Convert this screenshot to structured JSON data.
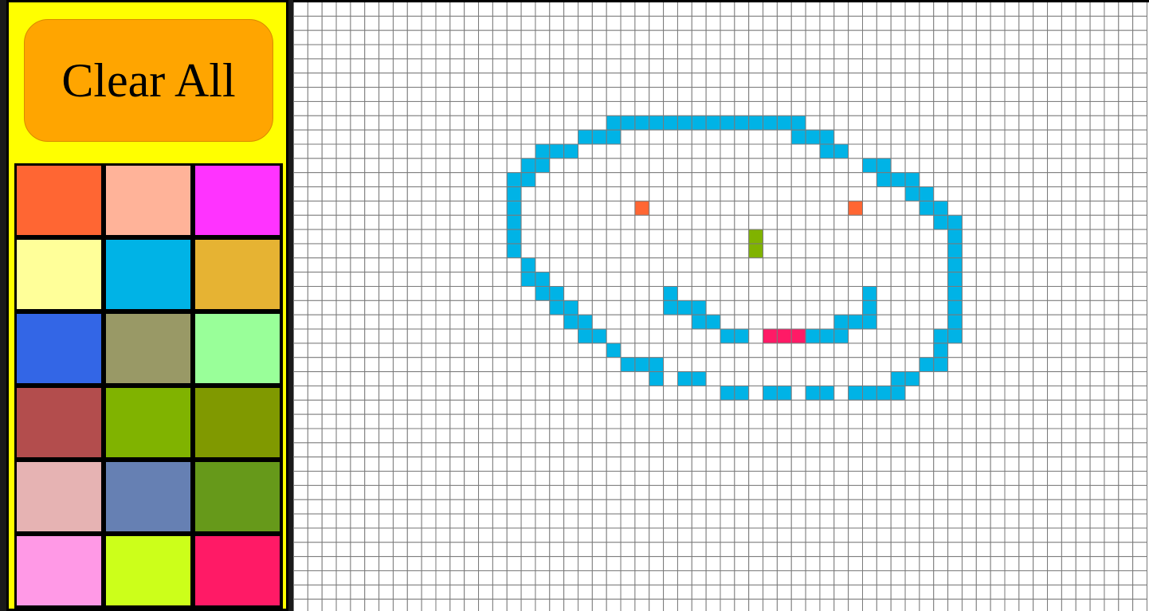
{
  "toolbar": {
    "clear_label": "Clear All"
  },
  "palette": {
    "colors": [
      "#ff6633",
      "#ffb399",
      "#ff33ff",
      "#ffff99",
      "#00b3e6",
      "#e6b333",
      "#3366e6",
      "#999966",
      "#99ff99",
      "#b34d4d",
      "#80b300",
      "#809900",
      "#e6b3b3",
      "#6680b3",
      "#66991a",
      "#ff99e6",
      "#ccff1a",
      "#ff1a66"
    ]
  },
  "grid": {
    "columns": 60,
    "rows": 43,
    "background": "#ffffff",
    "line_color": "#7a7a7a",
    "painted": [
      {
        "color": "#00b3e6",
        "cells": [
          [
            22,
            8
          ],
          [
            23,
            8
          ],
          [
            24,
            8
          ],
          [
            25,
            8
          ],
          [
            26,
            8
          ],
          [
            27,
            8
          ],
          [
            28,
            8
          ],
          [
            29,
            8
          ],
          [
            30,
            8
          ],
          [
            31,
            8
          ],
          [
            32,
            8
          ],
          [
            33,
            8
          ],
          [
            34,
            8
          ],
          [
            35,
            8
          ],
          [
            20,
            9
          ],
          [
            21,
            9
          ],
          [
            22,
            9
          ],
          [
            35,
            9
          ],
          [
            36,
            9
          ],
          [
            37,
            9
          ],
          [
            17,
            10
          ],
          [
            18,
            10
          ],
          [
            19,
            10
          ],
          [
            37,
            10
          ],
          [
            38,
            10
          ],
          [
            16,
            11
          ],
          [
            17,
            11
          ],
          [
            40,
            11
          ],
          [
            41,
            11
          ],
          [
            15,
            12
          ],
          [
            16,
            12
          ],
          [
            41,
            12
          ],
          [
            42,
            12
          ],
          [
            43,
            12
          ],
          [
            15,
            13
          ],
          [
            43,
            13
          ],
          [
            44,
            13
          ],
          [
            15,
            14
          ],
          [
            44,
            14
          ],
          [
            45,
            14
          ],
          [
            15,
            15
          ],
          [
            45,
            15
          ],
          [
            46,
            15
          ],
          [
            15,
            16
          ],
          [
            46,
            16
          ],
          [
            15,
            17
          ],
          [
            46,
            17
          ],
          [
            16,
            18
          ],
          [
            46,
            18
          ],
          [
            16,
            19
          ],
          [
            17,
            19
          ],
          [
            46,
            19
          ],
          [
            17,
            20
          ],
          [
            18,
            20
          ],
          [
            26,
            20
          ],
          [
            40,
            20
          ],
          [
            46,
            20
          ],
          [
            18,
            21
          ],
          [
            19,
            21
          ],
          [
            26,
            21
          ],
          [
            27,
            21
          ],
          [
            28,
            21
          ],
          [
            40,
            21
          ],
          [
            46,
            21
          ],
          [
            19,
            22
          ],
          [
            20,
            22
          ],
          [
            28,
            22
          ],
          [
            29,
            22
          ],
          [
            38,
            22
          ],
          [
            39,
            22
          ],
          [
            40,
            22
          ],
          [
            46,
            22
          ],
          [
            20,
            23
          ],
          [
            21,
            23
          ],
          [
            30,
            23
          ],
          [
            31,
            23
          ],
          [
            36,
            23
          ],
          [
            37,
            23
          ],
          [
            38,
            23
          ],
          [
            45,
            23
          ],
          [
            46,
            23
          ],
          [
            22,
            24
          ],
          [
            45,
            24
          ],
          [
            23,
            25
          ],
          [
            24,
            25
          ],
          [
            25,
            25
          ],
          [
            44,
            25
          ],
          [
            45,
            25
          ],
          [
            25,
            26
          ],
          [
            27,
            26
          ],
          [
            28,
            26
          ],
          [
            42,
            26
          ],
          [
            43,
            26
          ],
          [
            30,
            27
          ],
          [
            31,
            27
          ],
          [
            33,
            27
          ],
          [
            34,
            27
          ],
          [
            36,
            27
          ],
          [
            37,
            27
          ],
          [
            39,
            27
          ],
          [
            40,
            27
          ],
          [
            41,
            27
          ],
          [
            42,
            27
          ]
        ]
      },
      {
        "color": "#ff6633",
        "cells": [
          [
            24,
            14
          ],
          [
            39,
            14
          ]
        ]
      },
      {
        "color": "#80b300",
        "cells": [
          [
            32,
            16
          ],
          [
            32,
            17
          ]
        ]
      },
      {
        "color": "#ff1a66",
        "cells": [
          [
            33,
            23
          ],
          [
            34,
            23
          ],
          [
            35,
            23
          ]
        ]
      }
    ]
  }
}
